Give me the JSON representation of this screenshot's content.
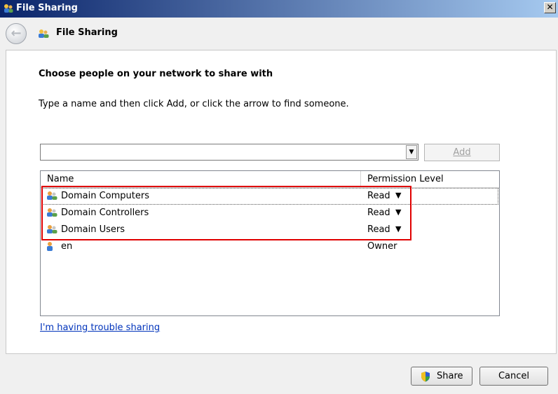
{
  "window": {
    "title": "File Sharing",
    "close_label": "✕"
  },
  "nav": {
    "back_arrow": "←",
    "title": "File Sharing"
  },
  "main": {
    "heading": "Choose people on your network to share with",
    "instruction": "Type a name and then click Add, or click the arrow to find someone.",
    "name_input": {
      "value": "",
      "placeholder": ""
    },
    "dropdown_arrow": "▼",
    "add_button": {
      "label": "Add"
    }
  },
  "list": {
    "headers": {
      "name": "Name",
      "permission": "Permission Level"
    },
    "rows": [
      {
        "name": "Domain Computers",
        "permission": "Read",
        "arrow": "▼",
        "icon": "group-users-icon"
      },
      {
        "name": "Domain Controllers",
        "permission": "Read",
        "arrow": "▼",
        "icon": "group-users-icon"
      },
      {
        "name": "Domain Users",
        "permission": "Read",
        "arrow": "▼",
        "icon": "group-users-icon"
      },
      {
        "name": "en",
        "permission": "Owner",
        "arrow": "",
        "icon": "single-user-icon"
      }
    ]
  },
  "links": {
    "trouble": "I'm having trouble sharing"
  },
  "footer": {
    "share_label": "Share",
    "cancel_label": "Cancel"
  },
  "colors": {
    "highlight": "#e00000",
    "link": "#0033bb",
    "titlebar_start": "#0a246a",
    "titlebar_end": "#a6caf0"
  }
}
